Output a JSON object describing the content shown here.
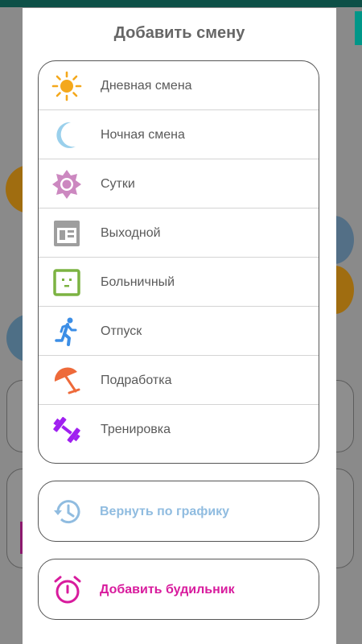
{
  "dialog": {
    "title": "Добавить смену",
    "shift_types": [
      {
        "label": "Дневная смена",
        "icon": "sun-icon",
        "color": "#f4a81c"
      },
      {
        "label": "Ночная смена",
        "icon": "moon-icon",
        "color": "#9ad0ec"
      },
      {
        "label": "Сутки",
        "icon": "gear-sun-icon",
        "color": "#cc88c0"
      },
      {
        "label": "Выходной",
        "icon": "weekend-calendar-icon",
        "color": "#9e9e9e"
      },
      {
        "label": "Больничный",
        "icon": "sick-face-icon",
        "color": "#7cb342"
      },
      {
        "label": "Отпуск",
        "icon": "running-person-icon",
        "color": "#3c8ee6"
      },
      {
        "label": "Подработка",
        "icon": "beach-umbrella-icon",
        "color": "#ee6a3a"
      },
      {
        "label": "Тренировка",
        "icon": "dumbbell-icon",
        "color": "#a020f0"
      }
    ],
    "restore": {
      "label": "Вернуть по графику",
      "icon": "history-icon",
      "color": "#90bce0"
    },
    "alarm": {
      "label": "Добавить будильник",
      "icon": "alarm-clock-icon",
      "color": "#d81b9d"
    }
  }
}
